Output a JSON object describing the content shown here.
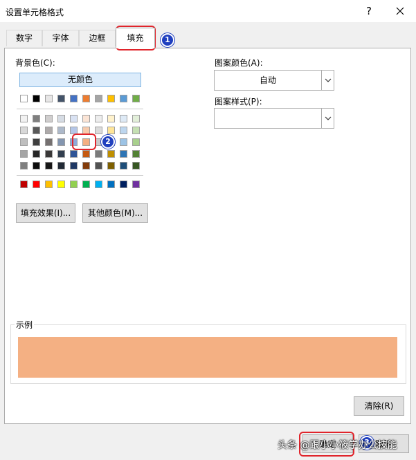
{
  "window": {
    "title": "设置单元格格式",
    "help": "?"
  },
  "tabs": [
    {
      "label": "数字",
      "active": false
    },
    {
      "label": "字体",
      "active": false
    },
    {
      "label": "边框",
      "active": false
    },
    {
      "label": "填充",
      "active": true
    }
  ],
  "fill": {
    "bg_label": "背景色(C):",
    "no_color": "无颜色",
    "theme_top_row": [
      "#ffffff",
      "#000000",
      "#e7e6e6",
      "#44546a",
      "#4472c4",
      "#ed7d31",
      "#a5a5a5",
      "#ffc000",
      "#5b9bd5",
      "#70ad47"
    ],
    "theme_shades": [
      [
        "#f2f2f2",
        "#7f7f7f",
        "#d0cece",
        "#d6dce4",
        "#d9e2f3",
        "#fbe4d5",
        "#ededed",
        "#fff2cc",
        "#deeaf6",
        "#e2efd9"
      ],
      [
        "#d8d8d8",
        "#595959",
        "#aeaaaa",
        "#adb9ca",
        "#b4c6e7",
        "#f7caac",
        "#dbdbdb",
        "#ffe598",
        "#bdd6ee",
        "#c5e0b3"
      ],
      [
        "#bfbfbf",
        "#3f3f3f",
        "#757070",
        "#8496b0",
        "#8eaadb",
        "#f4b083",
        "#c9c9c9",
        "#ffd966",
        "#9cc3e5",
        "#a8d08d"
      ],
      [
        "#a5a5a5",
        "#262626",
        "#3a3838",
        "#323f4f",
        "#2f5496",
        "#c55a11",
        "#7b7b7b",
        "#bf8f00",
        "#2e75b5",
        "#538135"
      ],
      [
        "#7f7f7f",
        "#0d0d0d",
        "#171616",
        "#222a35",
        "#1f3864",
        "#833c0b",
        "#525252",
        "#7f6000",
        "#1e4e79",
        "#375623"
      ]
    ],
    "standard_colors": [
      "#c00000",
      "#ff0000",
      "#ffc000",
      "#ffff00",
      "#92d050",
      "#00b050",
      "#00b0f0",
      "#0070c0",
      "#002060",
      "#7030a0"
    ],
    "fill_effects_btn": "填充效果(I)...",
    "more_colors_btn": "其他颜色(M)...",
    "pattern_color_label": "图案颜色(A):",
    "pattern_color_value": "自动",
    "pattern_style_label": "图案样式(P):",
    "pattern_style_value": "",
    "sample_label": "示例",
    "sample_color": "#f4b083",
    "clear_btn": "清除(R)"
  },
  "footer": {
    "ok_btn": "确定",
    "cancel_btn": "取消"
  },
  "callouts": [
    "1",
    "2",
    "3"
  ],
  "watermark": "头条 @跟小小筱学办公技能"
}
